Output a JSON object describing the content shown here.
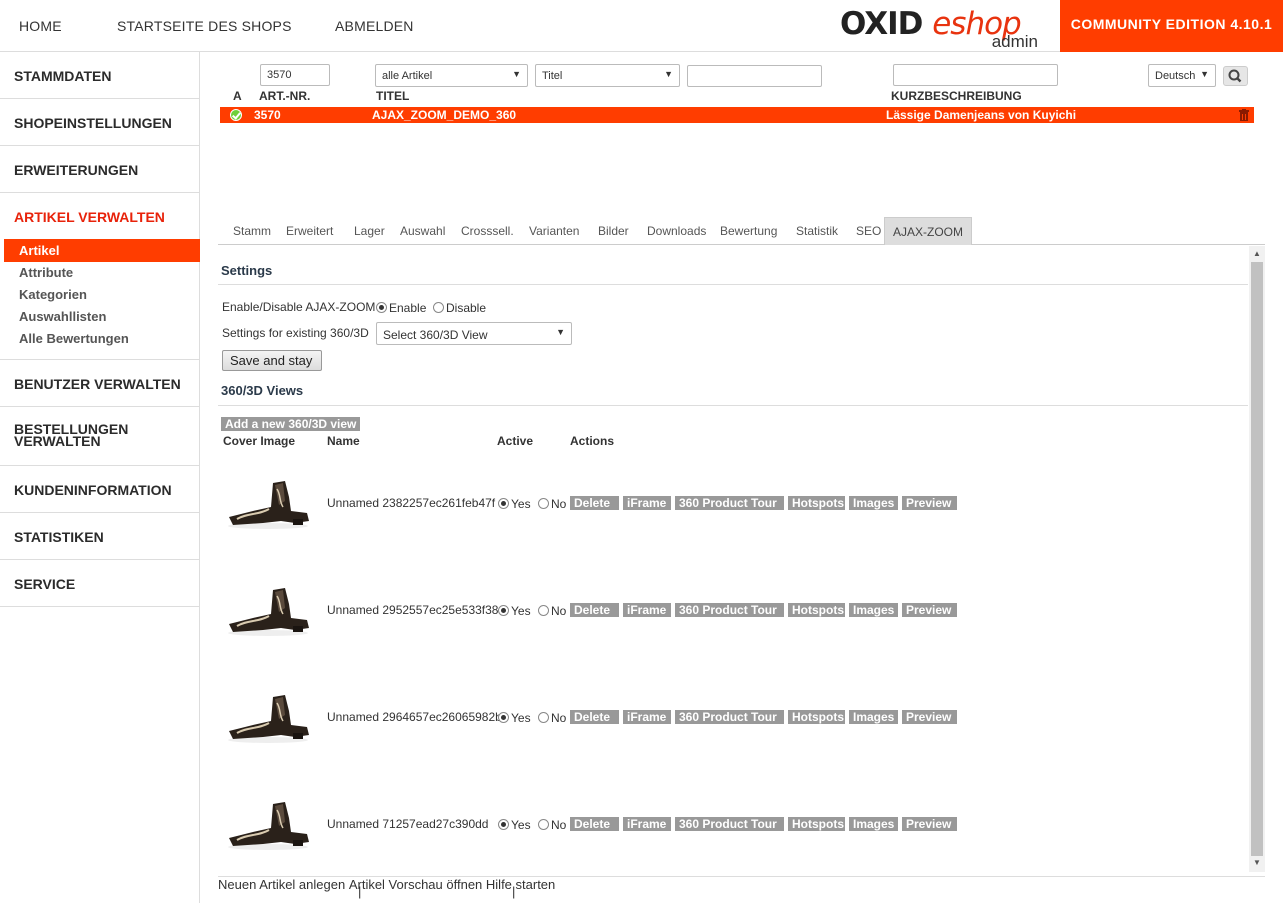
{
  "topnav": {
    "home": "HOME",
    "shop_start": "STARTSEITE DES SHOPS",
    "logout": "ABMELDEN"
  },
  "logo": {
    "brand_oxid": "OXID",
    "brand_eshop": "eshop",
    "sub": "admin"
  },
  "edition": "COMMUNITY EDITION 4.10.1",
  "sidebar": {
    "sections": [
      "STAMMDATEN",
      "SHOPEINSTELLUNGEN",
      "ERWEITERUNGEN",
      "ARTIKEL VERWALTEN",
      "BENUTZER VERWALTEN",
      "BESTELLUNGEN VERWALTEN",
      "KUNDENINFORMATION",
      "STATISTIKEN",
      "SERVICE"
    ],
    "sub": [
      "Artikel",
      "Attribute",
      "Kategorien",
      "Auswahllisten",
      "Alle Bewertungen"
    ],
    "active_color": "#ff3d00"
  },
  "filters": {
    "artnum": "3570",
    "article_filter": "alle Artikel",
    "field": "Titel",
    "title_value": "",
    "shortdesc_value": "",
    "language": "Deutsch"
  },
  "columns": {
    "a": "A",
    "artnum": "ART.-NR.",
    "title": "TITEL",
    "shortdesc": "KURZBESCHREIBUNG"
  },
  "row": {
    "artnum": "3570",
    "title": "AJAX_ZOOM_DEMO_360",
    "shortdesc": "Lässige Damenjeans von Kuyichi"
  },
  "tabs": [
    "Stamm",
    "Erweitert",
    "Lager",
    "Auswahl",
    "Crosssell.",
    "Varianten",
    "Bilder",
    "Downloads",
    "Bewertung",
    "Statistik",
    "SEO",
    "AJAX-ZOOM"
  ],
  "settings": {
    "heading": "Settings",
    "enable_label": "Enable/Disable AJAX-ZOOM",
    "enable": "Enable",
    "disable": "Disable",
    "existing_label": "Settings for existing 360/3D",
    "existing_select": "Select 360/3D View",
    "save": "Save and stay"
  },
  "views": {
    "heading": "360/3D Views",
    "add": "Add a new 360/3D view",
    "headers": {
      "cover": "Cover Image",
      "name": "Name",
      "active": "Active",
      "actions": "Actions"
    },
    "yes": "Yes",
    "no": "No",
    "actions": [
      "Delete",
      "iFrame",
      "360 Product Tour",
      "Hotspots",
      "Images",
      "Preview"
    ],
    "items": [
      {
        "name": "Unnamed 2382257ec261feb47f"
      },
      {
        "name": "Unnamed 2952557ec25e533f38"
      },
      {
        "name": "Unnamed 2964657ec26065982b"
      },
      {
        "name": "Unnamed 71257ead27c390dd"
      }
    ]
  },
  "footer": {
    "new_article": "Neuen Artikel anlegen",
    "preview": "Artikel Vorschau öffnen",
    "help": "Hilfe starten"
  }
}
